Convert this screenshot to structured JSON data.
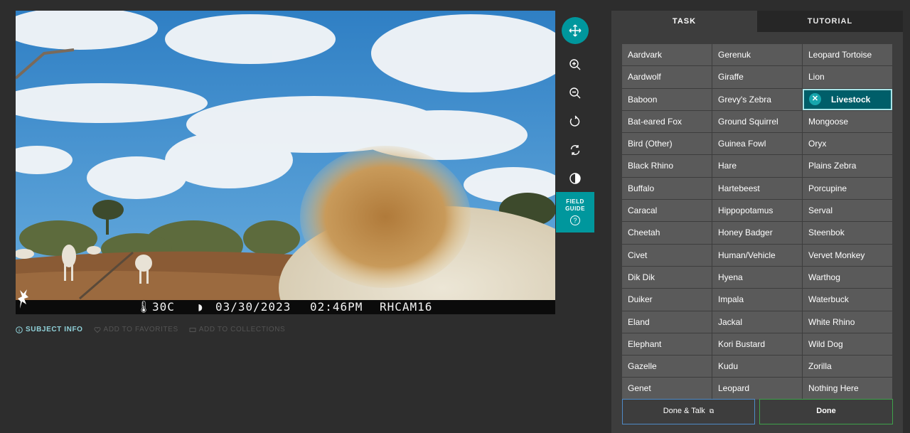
{
  "camera": {
    "temp": "30C",
    "date": "03/30/2023",
    "time": "02:46PM",
    "camera_id": "RHCAM16"
  },
  "tools": {
    "move": "move-icon",
    "zoom_in": "zoom-in-icon",
    "zoom_out": "zoom-out-icon",
    "rotate": "rotate-icon",
    "reset": "reset-icon",
    "invert": "invert-icon"
  },
  "field_guide": {
    "line1": "FIELD",
    "line2": "GUIDE",
    "icon": "?"
  },
  "meta": {
    "subject_info": "SUBJECT INFO",
    "add_favorites": "ADD TO FAVORITES",
    "add_collections": "ADD TO COLLECTIONS"
  },
  "tabs": {
    "task": "TASK",
    "tutorial": "TUTORIAL"
  },
  "species": [
    "Aardvark",
    "Gerenuk",
    "Leopard Tortoise",
    "Aardwolf",
    "Giraffe",
    "Lion",
    "Baboon",
    "Grevy's Zebra",
    "Livestock",
    "Bat-eared Fox",
    "Ground Squirrel",
    "Mongoose",
    "Bird (Other)",
    "Guinea Fowl",
    "Oryx",
    "Black Rhino",
    "Hare",
    "Plains Zebra",
    "Buffalo",
    "Hartebeest",
    "Porcupine",
    "Caracal",
    "Hippopotamus",
    "Serval",
    "Cheetah",
    "Honey Badger",
    "Steenbok",
    "Civet",
    "Human/Vehicle",
    "Vervet Monkey",
    "Dik Dik",
    "Hyena",
    "Warthog",
    "Duiker",
    "Impala",
    "Waterbuck",
    "Eland",
    "Jackal",
    "White Rhino",
    "Elephant",
    "Kori Bustard",
    "Wild Dog",
    "Gazelle",
    "Kudu",
    "Zorilla",
    "Genet",
    "Leopard",
    "Nothing Here"
  ],
  "selected_species": "Livestock",
  "buttons": {
    "done_talk": "Done & Talk",
    "done": "Done"
  },
  "colors": {
    "accent": "#00979d",
    "selected_bg": "#005e69",
    "done_border": "#3ea24a",
    "talk_border": "#4f8ac6"
  }
}
